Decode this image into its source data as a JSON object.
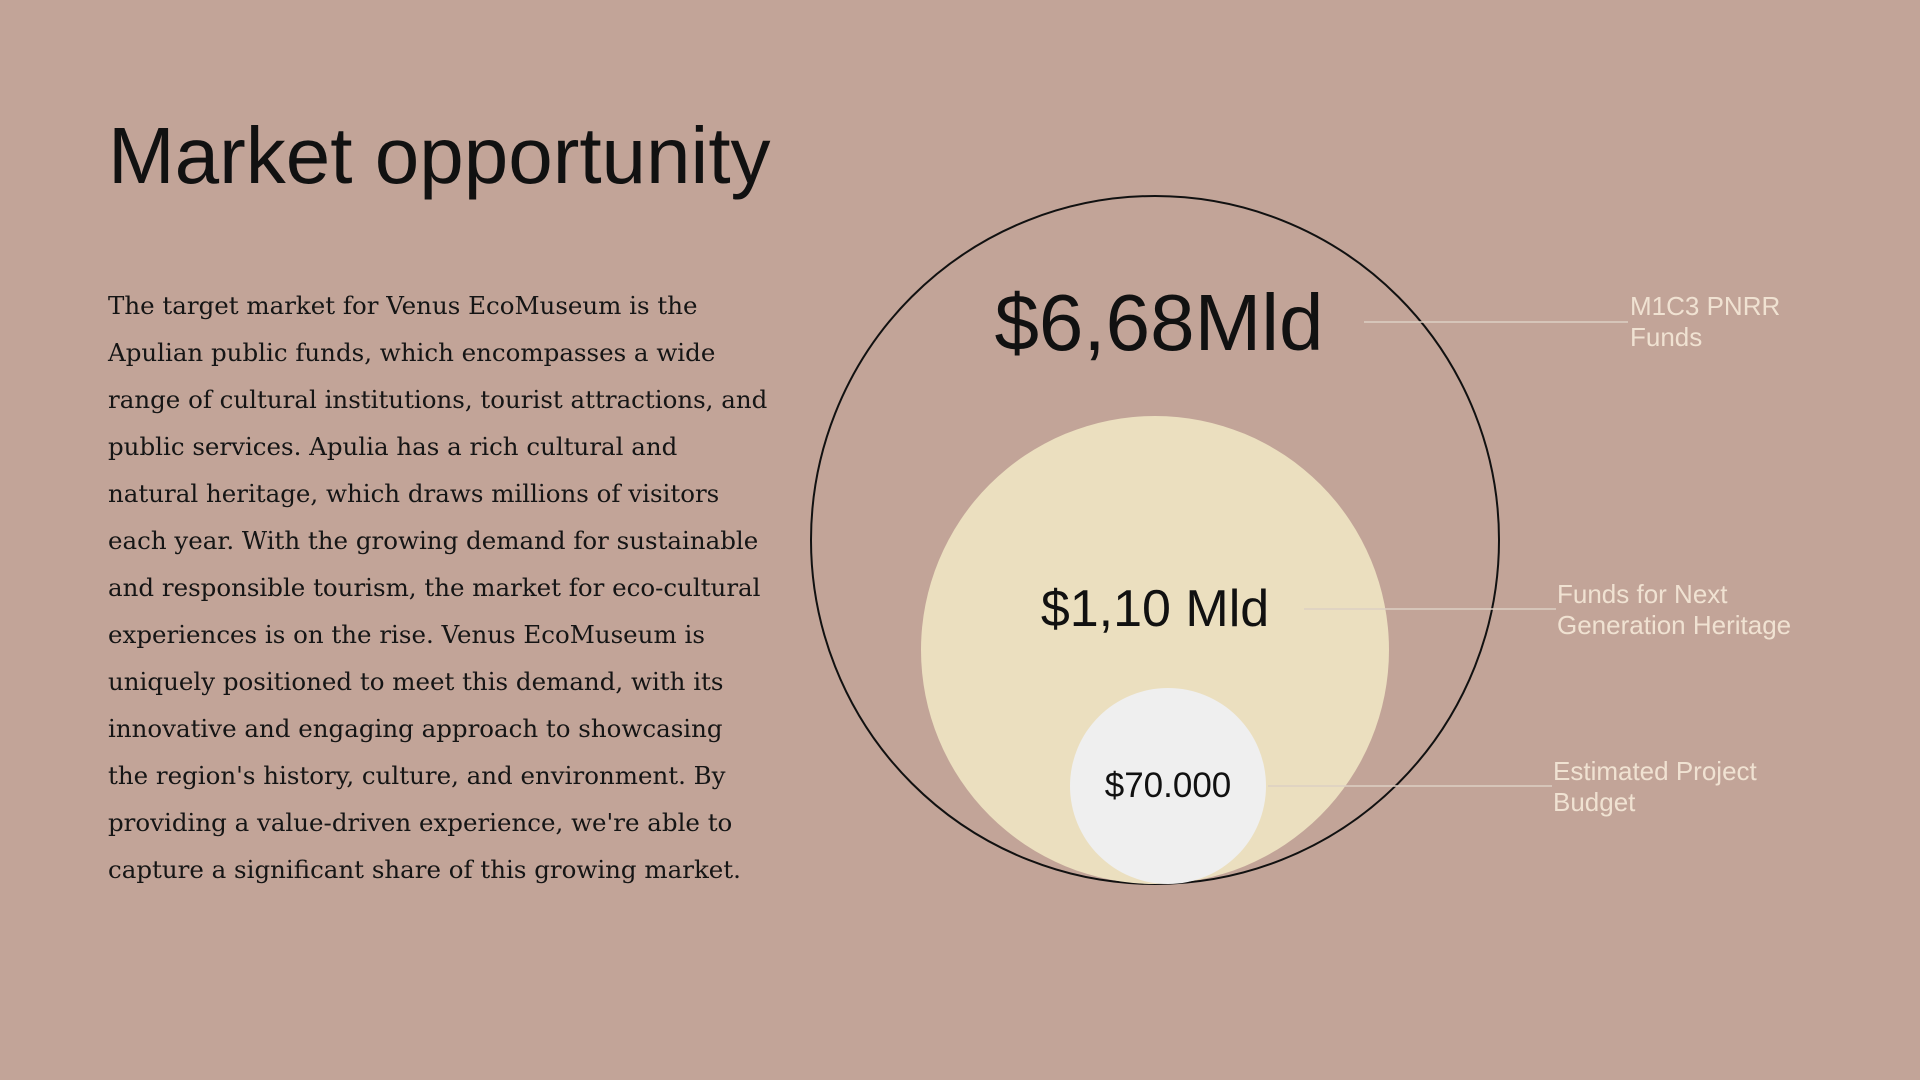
{
  "slide": {
    "title": "Market opportunity",
    "body": "The target market for Venus EcoMuseum is the Apulian public funds, which encompasses a wide range of cultural institutions, tourist attractions, and public services. Apulia has a rich cultural and natural heritage, which draws millions of visitors each year. With the growing demand for sustainable and responsible tourism, the market for eco-cultural experiences is on the rise. Venus EcoMuseum is uniquely positioned to meet this demand, with its innovative and engaging approach to showcasing the region's history, culture, and environment. By providing a value-driven experience, we're able to capture a significant share of this growing market."
  },
  "diagram": {
    "outer": {
      "value": "$6,68Mld",
      "label_lines": [
        "M1C3 PNRR",
        "Funds"
      ]
    },
    "middle": {
      "value": "$1,10 Mld",
      "label_lines": [
        "Funds for Next",
        "Generation Heritage"
      ]
    },
    "inner": {
      "value": "$70.000",
      "label_lines": [
        "Estimated Project",
        "Budget"
      ]
    }
  },
  "colors": {
    "background": "#c2a498",
    "middle_fill": "#ebdfbf",
    "inner_fill": "#efefef",
    "outer_stroke": "#111111",
    "leader_line": "#ddd0c4",
    "label_text": "#f0e2d2"
  }
}
